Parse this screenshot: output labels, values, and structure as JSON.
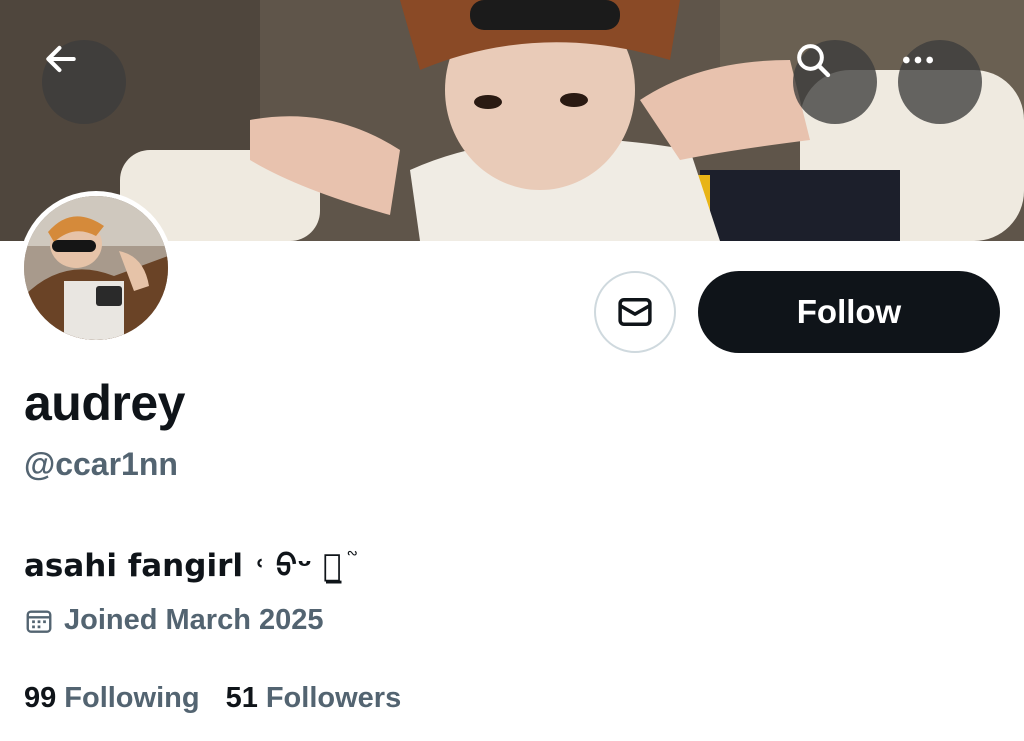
{
  "profile": {
    "display_name": "audrey",
    "handle": "@ccar1nn",
    "bio": "asahi fangirl ˓ ᢒᵕ ᢒ̲ ֘ ",
    "joined": "Joined March 2025"
  },
  "actions": {
    "follow_label": "Follow"
  },
  "stats": {
    "following_count": "99",
    "following_label": "Following",
    "followers_count": "51",
    "followers_label": "Followers"
  },
  "icons": {
    "back": "back-arrow-icon",
    "search": "search-icon",
    "more": "more-horizontal-icon",
    "message": "mail-icon",
    "calendar": "calendar-icon"
  },
  "colors": {
    "primary_text": "#0f1419",
    "secondary_text": "#536471",
    "follow_button_bg": "#0f1419",
    "overlay_button_bg": "#3c3c3c"
  }
}
